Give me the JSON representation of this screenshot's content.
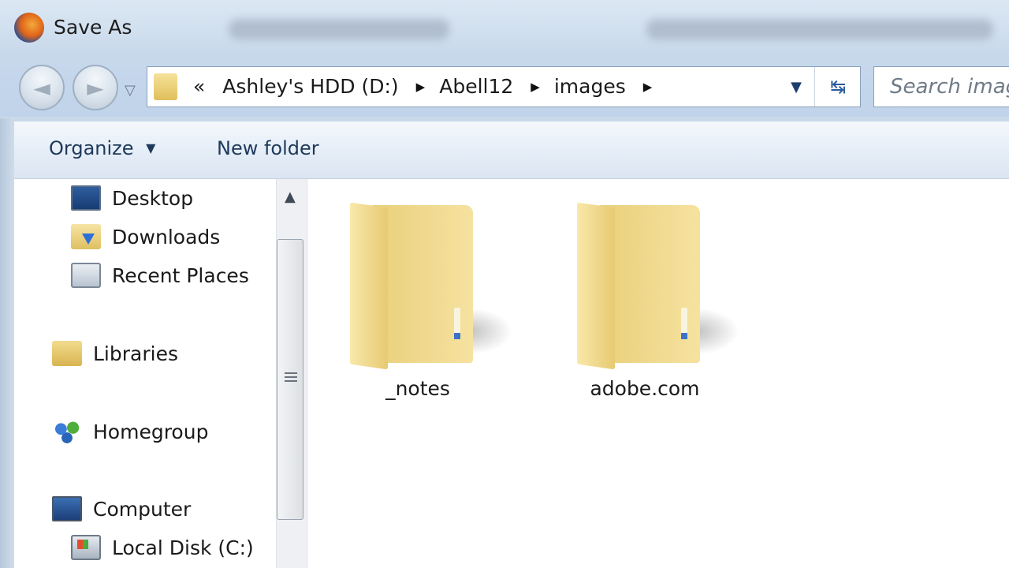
{
  "window": {
    "title": "Save As"
  },
  "navigation": {
    "back_glyph": "◄",
    "forward_glyph": "►",
    "dropdown_glyph": "▽"
  },
  "address_bar": {
    "overflow_glyph": "«",
    "breadcrumbs": [
      "Ashley's HDD (D:)",
      "Abell12",
      "images"
    ],
    "separator_glyph": "▶",
    "dropdown_glyph": "▼",
    "refresh_glyph": "↹"
  },
  "search": {
    "placeholder": "Search images"
  },
  "toolbar": {
    "organize_label": "Organize",
    "organize_arrow": "▼",
    "new_folder_label": "New folder"
  },
  "nav_pane": {
    "items": [
      {
        "label": "Desktop",
        "icon": "desktop-icon"
      },
      {
        "label": "Downloads",
        "icon": "downloads-icon"
      },
      {
        "label": "Recent Places",
        "icon": "recent-places-icon"
      },
      {
        "label": "Libraries",
        "icon": "libraries-icon"
      },
      {
        "label": "Homegroup",
        "icon": "homegroup-icon"
      },
      {
        "label": "Computer",
        "icon": "computer-icon"
      },
      {
        "label": "Local Disk (C:)",
        "icon": "local-disk-icon"
      }
    ],
    "scroll_up_glyph": "▲"
  },
  "files": [
    {
      "name": "_notes",
      "type": "folder"
    },
    {
      "name": "adobe.com",
      "type": "folder"
    }
  ],
  "colors": {
    "titlebar": "#cfdeee",
    "toolbar_text": "#1e395b",
    "folder_yellow": "#f0d88a"
  }
}
